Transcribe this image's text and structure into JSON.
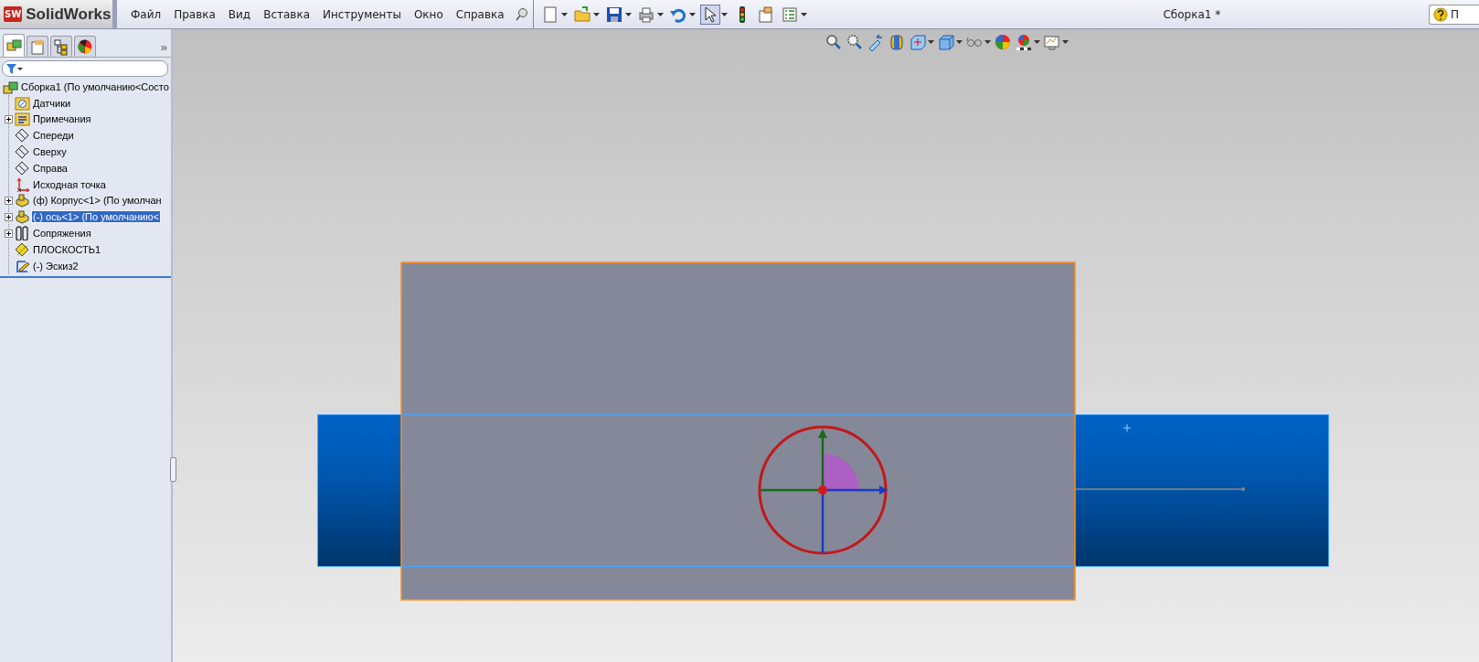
{
  "app": {
    "logo_badge": "SW",
    "logo_text": "SolidWorks"
  },
  "menu": [
    "Файл",
    "Правка",
    "Вид",
    "Вставка",
    "Инструменты",
    "Окно",
    "Справка"
  ],
  "window": {
    "title": "Сборка1 *"
  },
  "help_search": {
    "value": "П"
  },
  "panel_tabs": [
    {
      "selected": true
    },
    {
      "selected": false
    },
    {
      "selected": false
    },
    {
      "selected": false
    }
  ],
  "panel_tabs_more": "»",
  "tree": {
    "root": {
      "label": "Сборка1  (По умолчанию<Состо",
      "kind": "assembly",
      "children": [
        {
          "label": "Датчики",
          "kind": "sensors",
          "selected": false
        },
        {
          "label": "Примечания",
          "kind": "annotations",
          "expanded": false,
          "selected": false
        },
        {
          "label": "Спереди",
          "kind": "plane",
          "selected": false
        },
        {
          "label": "Сверху",
          "kind": "plane",
          "selected": false
        },
        {
          "label": "Справа",
          "kind": "plane",
          "selected": false
        },
        {
          "label": "Исходная точка",
          "kind": "origin",
          "selected": false
        },
        {
          "label": "(ф) Корпус<1> (По умолчан",
          "kind": "part",
          "expanded": false,
          "selected": false
        },
        {
          "label": "(-) ось<1> (По умолчанию<",
          "kind": "part",
          "expanded": false,
          "selected": true
        },
        {
          "label": "Сопряжения",
          "kind": "mates",
          "expanded": false,
          "selected": false
        },
        {
          "label": "ПЛОСКОСТЬ1",
          "kind": "refplane",
          "selected": false
        },
        {
          "label": "(-) Эскиз2",
          "kind": "sketch",
          "selected": false
        }
      ]
    }
  }
}
